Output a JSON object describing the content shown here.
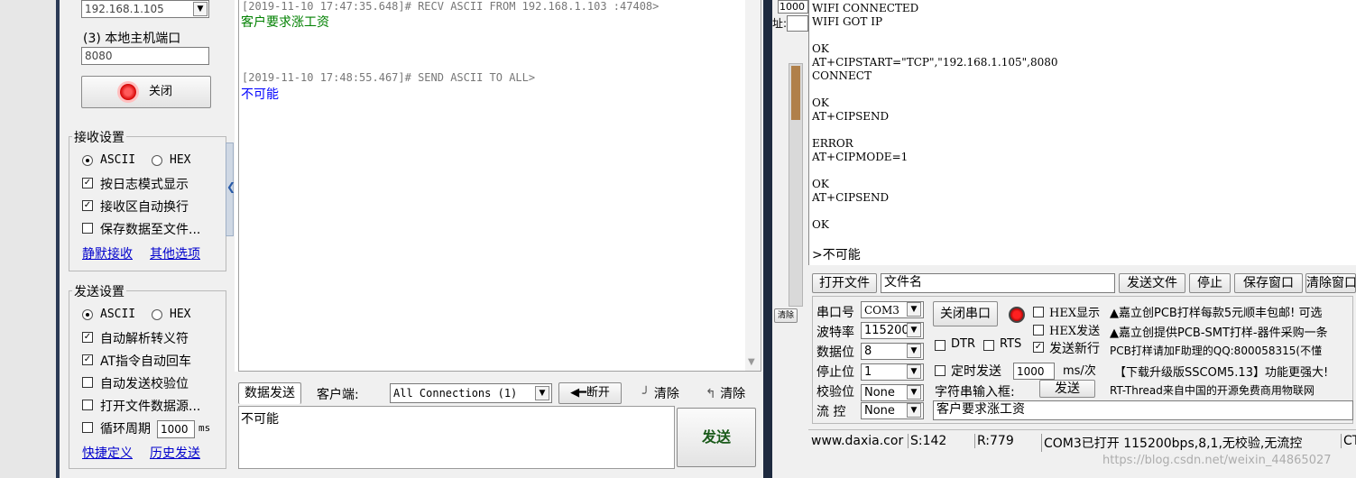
{
  "left": {
    "host_ip": "192.168.1.105",
    "local_port_label": "(3) 本地主机端口",
    "local_port": "8080",
    "close_label": "关闭",
    "recv_group_title": "接收设置",
    "recv_ascii": "ASCII",
    "recv_hex": "HEX",
    "recv_log_mode": "按日志模式显示",
    "recv_auto_wrap": "接收区自动换行",
    "recv_save_file": "保存数据至文件...",
    "silent_recv": "静默接收",
    "other_options": "其他选项",
    "send_group_title": "发送设置",
    "send_ascii": "ASCII",
    "send_hex": "HEX",
    "auto_escape": "自动解析转义符",
    "at_auto_cr": "AT指令自动回车",
    "auto_checksum": "自动发送校验位",
    "open_file_source": "打开文件数据源...",
    "loop_period": "循环周期",
    "loop_ms": "1000",
    "ms_unit": "ms",
    "shortcut_def": "快捷定义",
    "history_send": "历史发送"
  },
  "log": {
    "line1": "[2019-11-10 17:47:35.648]# RECV ASCII FROM 192.168.1.103 :47408>",
    "line2": "客户要求涨工资",
    "line3": "[2019-11-10 17:48:55.467]# SEND ASCII TO ALL>",
    "line4": "不可能"
  },
  "sendbar": {
    "tab_data_send": "数据发送",
    "client_label": "客户端:",
    "client_select": "All Connections (1)",
    "disconnect": "断开",
    "clear1": "清除",
    "clear2": "清除",
    "send_text": "不可能",
    "send_button": "发送"
  },
  "serial": {
    "top_value": "1000",
    "top_label": "址:",
    "small_clear": "清除",
    "terminal_lines": [
      "WIFI CONNECTED",
      "WIFI GOT IP",
      "",
      "OK",
      "AT+CIPSTART=\"TCP\",\"192.168.1.105\",8080",
      "CONNECT",
      "",
      "OK",
      "AT+CIPSEND",
      "",
      "ERROR",
      "AT+CIPMODE=1",
      "",
      "OK",
      "AT+CIPSEND",
      "",
      "OK"
    ],
    "terminal_last": ">不可能",
    "open_file": "打开文件",
    "file_name": "文件名",
    "send_file": "发送文件",
    "stop": "停止",
    "save_window": "保存窗口",
    "clear_window": "清除窗口",
    "port_label": "串口号",
    "port_value": "COM3",
    "close_port": "关闭串口",
    "hex_show": "HEX显示",
    "baud_label": "波特率",
    "baud_value": "115200",
    "hex_send": "HEX发送",
    "databits_label": "数据位",
    "databits_value": "8",
    "dtr": "DTR",
    "rts": "RTS",
    "send_newline": "发送新行",
    "stopbits_label": "停止位",
    "stopbits_value": "1",
    "timed_send": "定时发送",
    "timed_value": "1000",
    "ms_per": "ms/次",
    "parity_label": "校验位",
    "parity_value": "None",
    "string_input": "字符串输入框:",
    "send": "发送",
    "flow_label": "流 控",
    "flow_value": "None",
    "input_text": "客户要求涨工资",
    "ad1": "▲嘉立创PCB打样每款5元顺丰包邮! 可选",
    "ad2": "▲嘉立创提供PCB-SMT打样-器件采购一条",
    "ad3": "PCB打样请加F助理的QQ:800058315(不懂",
    "ad4": "【下载升级版SSCOM5.13】功能更强大!",
    "ad5": "RT-Thread来自中国的开源免费商用物联网",
    "status_site": "www.daxia.cor",
    "status_s": "S:142",
    "status_r": "R:779",
    "status_port": "COM3已打开  115200bps,8,1,无校验,无流控",
    "status_ct": "CT"
  },
  "watermark": "https://blog.csdn.net/weixin_44865027"
}
